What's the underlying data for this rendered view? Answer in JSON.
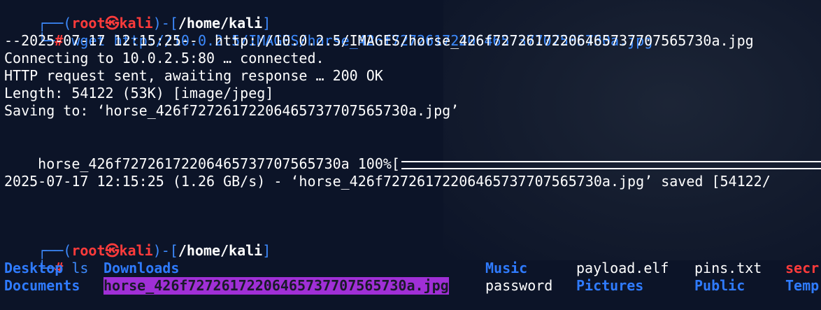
{
  "prompt": {
    "corner_top": "┌──(",
    "user": "root",
    "skull": "㉿",
    "host": "kali",
    "mid": ")-[",
    "path": "/home/kali",
    "end": "]",
    "corner_bottom": "└─",
    "hash": "#"
  },
  "commands": {
    "first": "wget http://10.0.2.5/IMAGES/horse_426f72726172206465737707565730a.jpg",
    "second": "ls"
  },
  "output": {
    "line1": "--2025-07-17 12:15:25--  http://10.0.2.5/IMAGES/horse_426f72726172206465737707565730a.jpg",
    "line2": "Connecting to 10.0.2.5:80 … connected.",
    "line3": "HTTP request sent, awaiting response … 200 OK",
    "line4": "Length: 54122 (53K) [image/jpeg]",
    "line5": "Saving to: ‘horse_426f72726172206465737707565730a.jpg’",
    "progress_name": "horse_426f72726172206465737707565730a 100%[",
    "progress_fraction": 1.0,
    "saved": "2025-07-17 12:15:25 (1.26 GB/s) - ‘horse_426f72726172206465737707565730a.jpg’ saved [54122/"
  },
  "ls": {
    "desktop": "Desktop",
    "documents": "Documents",
    "downloads": "Downloads",
    "horse_file": "horse_426f72726172206465737707565730a.jpg",
    "music": "Music",
    "password": "password",
    "payload": "payload.elf",
    "pictures": "Pictures",
    "pins": "pins.txt",
    "public": "Public",
    "secret_partial": "secr",
    "templates_partial": "Temp"
  },
  "colors": {
    "background": "#0c1428",
    "prompt_blue": "#3d8bff",
    "prompt_red": "#ff3b3b",
    "directory_blue": "#2f7bff",
    "image_highlight": "#a02fd6"
  }
}
